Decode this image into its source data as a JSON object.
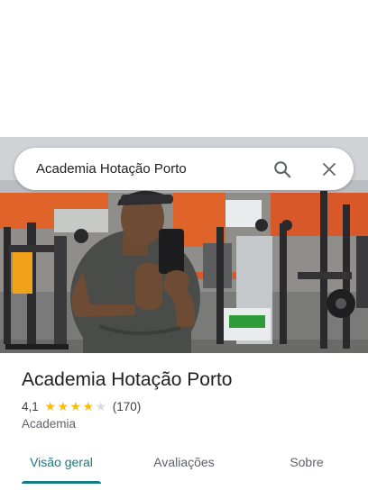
{
  "search": {
    "query": "Academia Hotação Porto",
    "search_icon": "search-icon",
    "close_icon": "close-icon"
  },
  "place": {
    "name": "Academia Hotação Porto",
    "rating": "4,1",
    "rating_value": 4.1,
    "stars_max": 5,
    "review_count": "(170)",
    "category": "Academia"
  },
  "photo": {
    "description_icon": "photo",
    "colors": {
      "ceiling": "#cfd3d6",
      "wall_orange": "#e0632a",
      "floor": "#7a7a78",
      "shirt": "#4a4c4a"
    }
  },
  "tabs": [
    {
      "label": "Visão geral",
      "active": true
    },
    {
      "label": "Avaliações",
      "active": false
    },
    {
      "label": "Sobre",
      "active": false
    }
  ],
  "colors": {
    "accent": "#137c84",
    "star": "#fbbc04",
    "star_empty": "#dadce0"
  }
}
